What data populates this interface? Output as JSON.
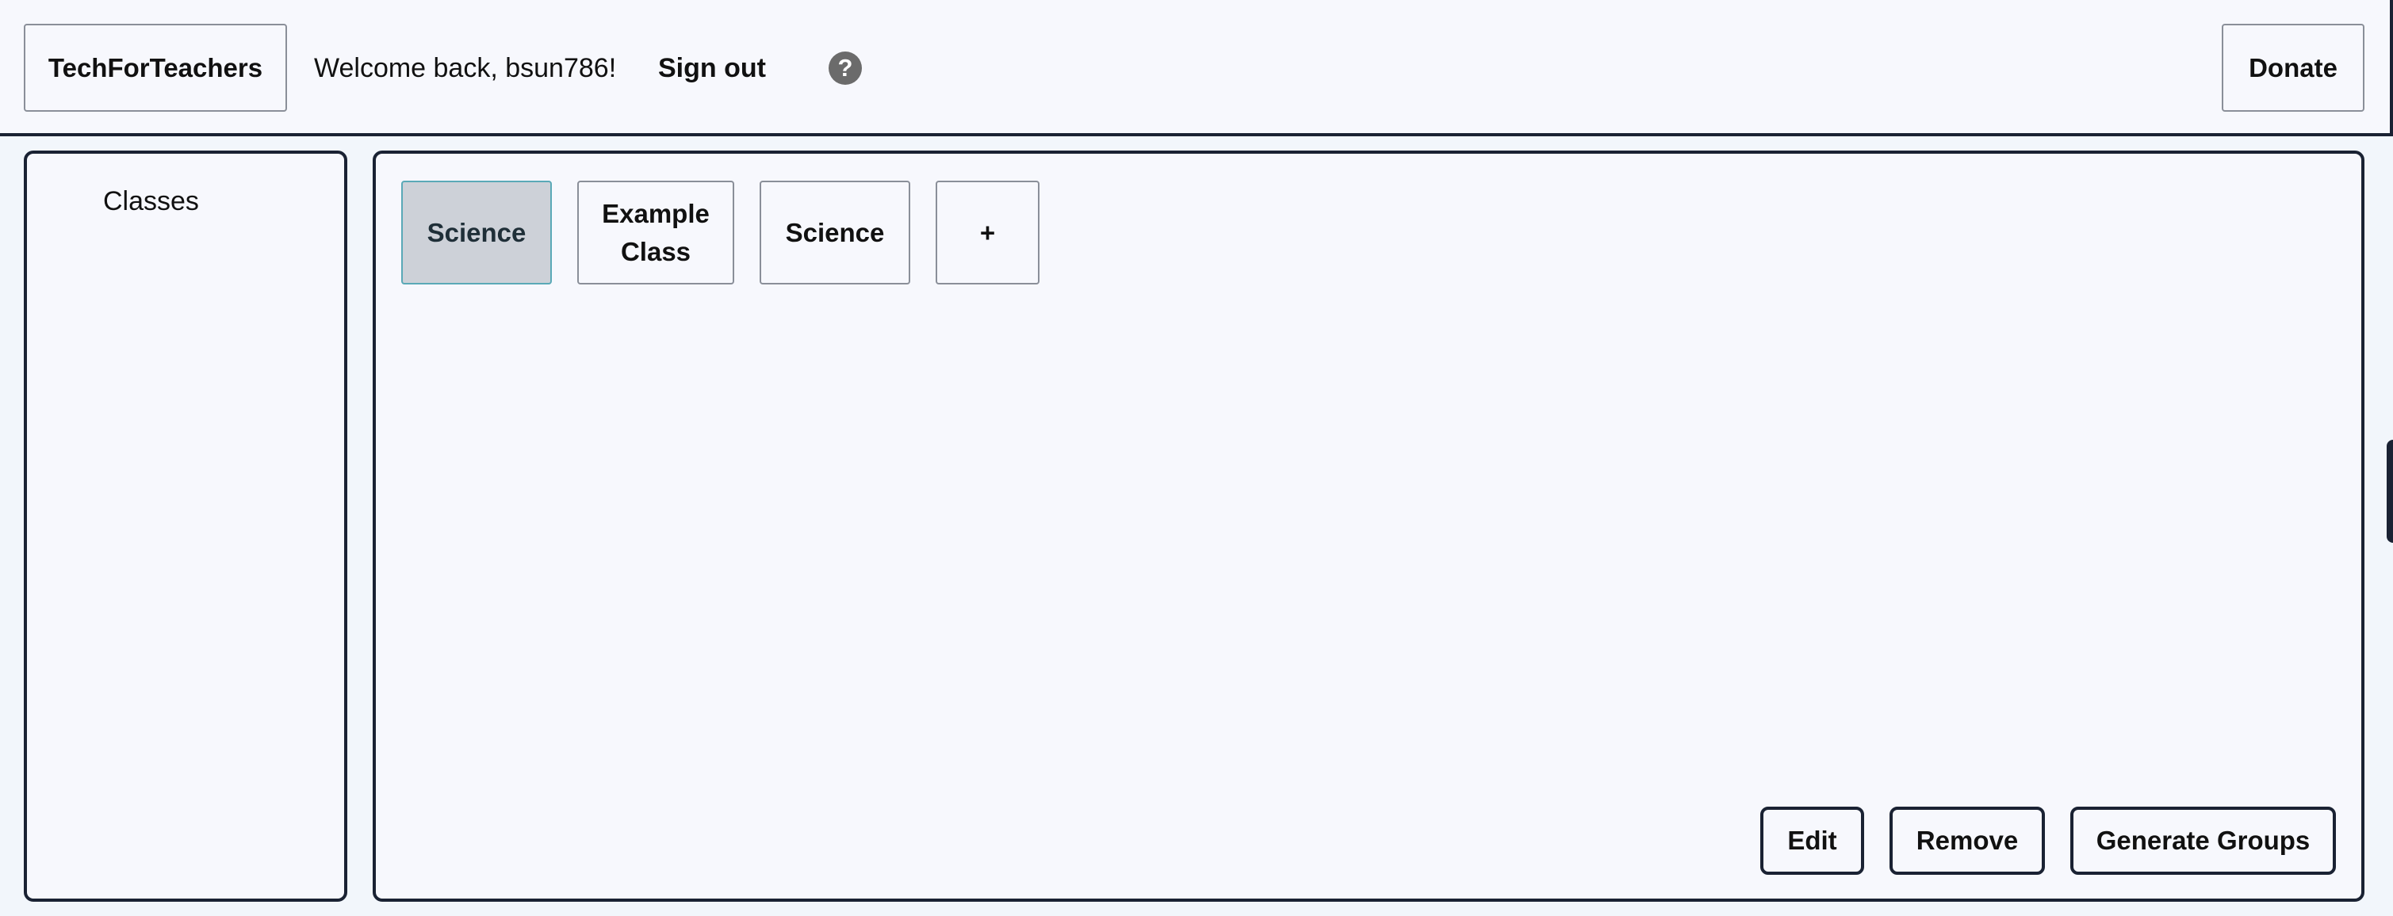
{
  "header": {
    "brand_label": "TechForTeachers",
    "welcome_text": "Welcome back, bsun786!",
    "signout_label": "Sign out",
    "help_glyph": "?",
    "donate_label": "Donate"
  },
  "sidebar": {
    "heading": "Classes"
  },
  "class_tabs": [
    {
      "label": "Science",
      "selected": true
    },
    {
      "label": "Example Class",
      "selected": false
    },
    {
      "label": "Science",
      "selected": false
    },
    {
      "label": "+",
      "selected": false
    }
  ],
  "actions": {
    "edit_label": "Edit",
    "remove_label": "Remove",
    "generate_label": "Generate Groups"
  },
  "colors": {
    "border": "#1a2233",
    "background": "#f7f8fd",
    "selected_tab_bg": "#cdd1d8",
    "selected_tab_border": "#5aa9b7",
    "help_icon_bg": "#6b6b6b"
  },
  "icons": {
    "help": "question-circle-icon",
    "add_class": "plus-icon"
  }
}
